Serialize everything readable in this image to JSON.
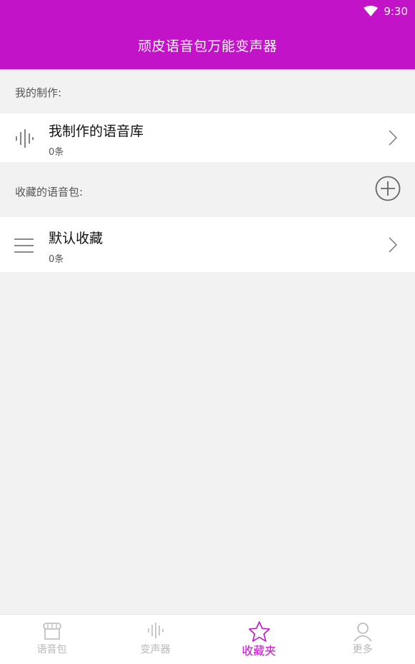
{
  "status": {
    "time": "9:30"
  },
  "app": {
    "title": "顽皮语音包万能变声器"
  },
  "sections": {
    "my_creations": "我的制作:",
    "favorites": "收藏的语音包:"
  },
  "rows": {
    "my_library": {
      "title": "我制作的语音库",
      "count": "0条"
    },
    "default_fav": {
      "title": "默认收藏",
      "count": "0条"
    }
  },
  "tabs": [
    {
      "label": "语音包",
      "icon": "sound-pack-icon"
    },
    {
      "label": "变声器",
      "icon": "waveform-icon"
    },
    {
      "label": "收藏夹",
      "icon": "star-icon",
      "active": true
    },
    {
      "label": "更多",
      "icon": "person-icon"
    }
  ],
  "colors": {
    "accent": "#c313c8",
    "background": "#f2f2f2"
  }
}
